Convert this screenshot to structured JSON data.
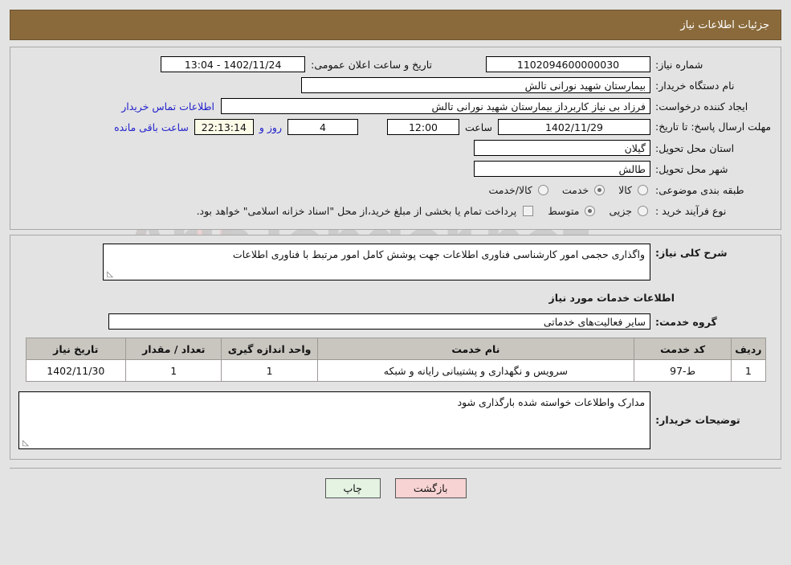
{
  "header": {
    "title": "جزئیات اطلاعات نیاز"
  },
  "top_panel": {
    "need_number_label": "شماره نیاز:",
    "need_number_value": "1102094600000030",
    "public_announce_label": "تاریخ و ساعت اعلان عمومی:",
    "public_announce_value": "1402/11/24 - 13:04",
    "buyer_org_label": "نام دستگاه خریدار:",
    "buyer_org_value": "بیمارستان شهید نورانی تالش",
    "request_creator_label": "ایجاد کننده درخواست:",
    "request_creator_value": "فرزاد بی نیاز کاربرداز بیمارستان شهید نورانی تالش",
    "buyer_contact_link": "اطلاعات تماس خریدار",
    "deadline_label": "مهلت ارسال پاسخ: تا تاریخ:",
    "deadline_date": "1402/11/29",
    "deadline_hour_label": "ساعت",
    "deadline_hour_value": "12:00",
    "remaining_days_value": "4",
    "remaining_days_label": "روز و",
    "remaining_time_value": "22:13:14",
    "remaining_time_label": "ساعت باقی مانده",
    "province_label": "استان محل تحویل:",
    "province_value": "گیلان",
    "city_label": "شهر محل تحویل:",
    "city_value": "طالش",
    "category_label": "طبقه بندی موضوعی:",
    "category_options": [
      {
        "label": "کالا",
        "selected": false
      },
      {
        "label": "خدمت",
        "selected": true
      },
      {
        "label": "کالا/خدمت",
        "selected": false
      }
    ],
    "process_label": "نوع فرآیند خرید :",
    "process_options": [
      {
        "label": "جزیی",
        "selected": false
      },
      {
        "label": "متوسط",
        "selected": true
      }
    ],
    "treasury_checkbox_checked": false,
    "treasury_note": "پرداخت تمام یا بخشی از مبلغ خرید،از محل \"اسناد خزانه اسلامی\" خواهد بود."
  },
  "mid_panel": {
    "general_desc_label": "شرح کلی نیاز:",
    "general_desc_value": "واگذاری حجمی امور کارشناسی فناوری اطلاعات جهت پوشش کامل امور مرتبط با فناوری اطلاعات",
    "services_section_title": "اطلاعات خدمات مورد نیاز",
    "service_group_label": "گروه خدمت:",
    "service_group_value": "سایر فعالیت‌های خدماتی",
    "table": {
      "columns": [
        "ردیف",
        "کد خدمت",
        "نام خدمت",
        "واحد اندازه گیری",
        "تعداد / مقدار",
        "تاریخ نیاز"
      ],
      "rows": [
        {
          "radif": "1",
          "code": "ط-97",
          "name": "سرویس و نگهداری و پشتیبانی رایانه و شبکه",
          "unit": "1",
          "qty": "1",
          "date": "1402/11/30"
        }
      ]
    },
    "buyer_notes_label": "توضیحات خریدار:",
    "buyer_notes_value": "مدارک واطلاعات خواسته شده بارگذاری شود"
  },
  "footer": {
    "print_label": "چاپ",
    "back_label": "بازگشت"
  },
  "watermark": {
    "text": "AriaTender.net"
  },
  "colors": {
    "header_bg": "#8a6a3b",
    "page_bg": "#e3e3e3",
    "link": "#2222cc",
    "table_header_bg": "#c9c6c0",
    "print_btn_bg": "#e4f3e2",
    "back_btn_bg": "#f8d3d3",
    "countdown_bg": "#fbfbe8"
  }
}
